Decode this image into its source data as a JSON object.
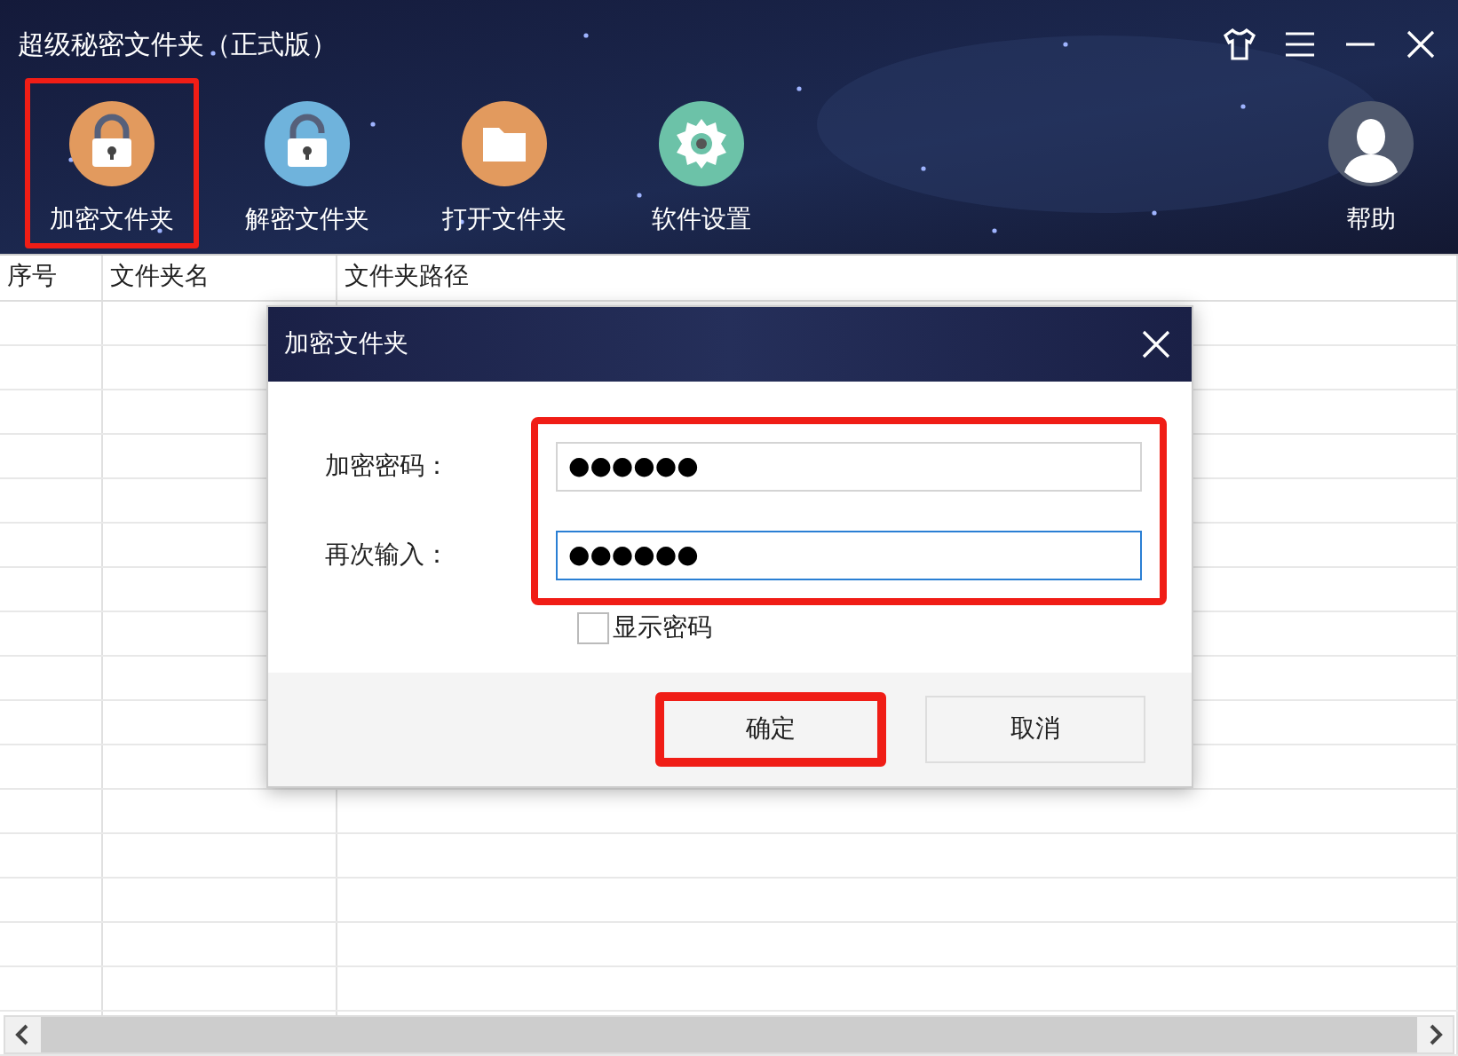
{
  "window": {
    "title": "超级秘密文件夹（正式版）",
    "controls": [
      {
        "kind": "skin"
      },
      {
        "kind": "menu"
      },
      {
        "kind": "minimize"
      },
      {
        "kind": "close"
      }
    ]
  },
  "toolbar": [
    {
      "label": "加密文件夹",
      "kind": "lock",
      "highlighted": true
    },
    {
      "label": "解密文件夹",
      "kind": "unlock",
      "highlighted": false
    },
    {
      "label": "打开文件夹",
      "kind": "folder",
      "highlighted": false
    },
    {
      "label": "软件设置",
      "kind": "gear",
      "highlighted": false
    }
  ],
  "help": {
    "label": "帮助"
  },
  "table": {
    "columns": [
      "序号",
      "文件夹名",
      "文件夹路径"
    ]
  },
  "dialog": {
    "title": "加密文件夹",
    "fields_highlighted": true,
    "fields": [
      {
        "label": "加密密码：",
        "value": "●●●●●●",
        "focused": false
      },
      {
        "label": "再次输入：",
        "value": "●●●●●●",
        "focused": true
      }
    ],
    "show_password": {
      "label": "显示密码",
      "checked": false
    },
    "buttons": [
      {
        "label": "确定",
        "highlighted": true
      },
      {
        "label": "取消",
        "highlighted": false
      }
    ]
  }
}
